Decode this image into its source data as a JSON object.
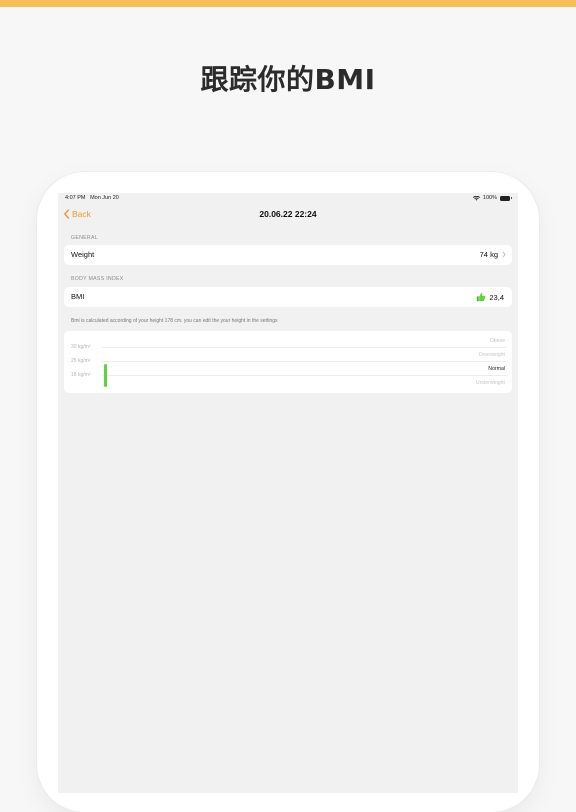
{
  "headline": "跟踪你的BMI",
  "status_bar": {
    "time": "4:07 PM",
    "date": "Mon Jun 20",
    "battery": "100%"
  },
  "nav": {
    "back_label": "Back",
    "title": "20.06.22 22:24"
  },
  "general": {
    "header": "GENERAL",
    "weight_label": "Weight",
    "weight_value": "74 kg"
  },
  "bmi_section": {
    "header": "BODY MASS INDEX",
    "label": "BMI",
    "value": "23,4",
    "note": "Bmi is calculated according of your height 178 cm. you can edit the your height in the settings"
  },
  "chart": {
    "y_labels": [
      "30 kg/m²",
      "25 kg/m²",
      "18 kg/m²"
    ],
    "categories": [
      "Obese",
      "Overweight",
      "Normal",
      "Underweight"
    ],
    "active_category": "Normal",
    "bar_color": "#63d13e",
    "accent_color": "#f1962f"
  },
  "chart_data": {
    "type": "bar",
    "categories": [
      "Obese",
      "Overweight",
      "Normal",
      "Underweight"
    ],
    "y_ticks": [
      18,
      25,
      30
    ],
    "values": [
      23.4
    ],
    "ylabel": "kg/m²"
  }
}
